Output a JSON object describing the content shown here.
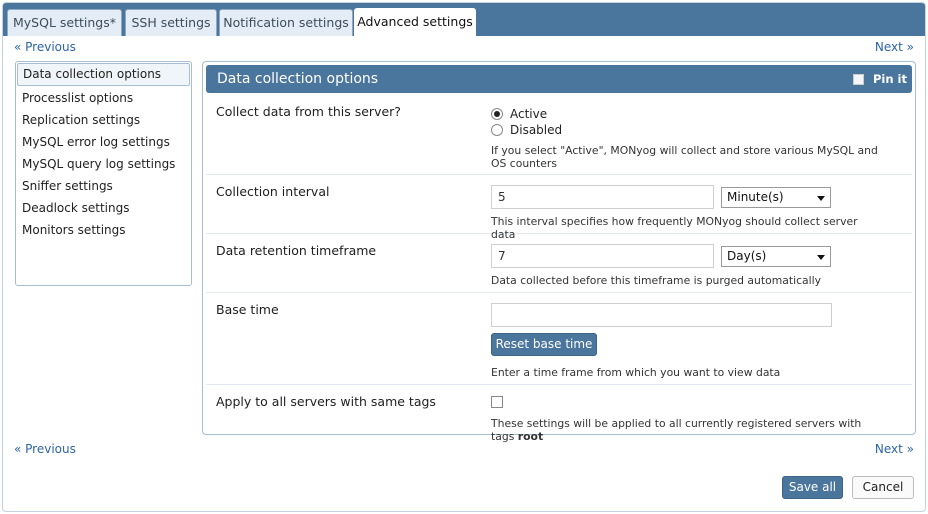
{
  "tabs": [
    {
      "label": "MySQL settings*"
    },
    {
      "label": "SSH settings"
    },
    {
      "label": "Notification settings"
    },
    {
      "label": "Advanced settings"
    }
  ],
  "nav": {
    "previous": "« Previous",
    "next": "Next »"
  },
  "sidebar": {
    "items": [
      {
        "label": "Data collection options"
      },
      {
        "label": "Processlist options"
      },
      {
        "label": "Replication settings"
      },
      {
        "label": "MySQL error log settings"
      },
      {
        "label": "MySQL query log settings"
      },
      {
        "label": "Sniffer settings"
      },
      {
        "label": "Deadlock settings"
      },
      {
        "label": "Monitors settings"
      }
    ]
  },
  "panel": {
    "title": "Data collection options",
    "pin_label": "Pin it",
    "pin_checked": false
  },
  "collect": {
    "label": "Collect data from this server?",
    "options": [
      {
        "label": "Active",
        "checked": true
      },
      {
        "label": "Disabled",
        "checked": false
      }
    ],
    "help": "If you select \"Active\", MONyog will collect and store various MySQL and OS counters"
  },
  "interval": {
    "label": "Collection interval",
    "value": "5",
    "unit": "Minute(s)",
    "help": "This interval specifies how frequently MONyog should collect server data"
  },
  "retention": {
    "label": "Data retention timeframe",
    "value": "7",
    "unit": "Day(s)",
    "help": "Data collected before this timeframe is purged automatically"
  },
  "base_time": {
    "label": "Base time",
    "value": "",
    "button": "Reset base time",
    "help": "Enter a time frame from which you want to view data"
  },
  "apply_tags": {
    "label": "Apply to all servers with same tags",
    "checked": false,
    "help_prefix": "These settings will be applied to all currently registered servers with tags",
    "tag": "root"
  },
  "footer": {
    "save_all": "Save all",
    "cancel": "Cancel"
  },
  "colors": {
    "header_blue": "#4a759c",
    "link_blue": "#2c64a8",
    "tab_inactive": "#e4edf5"
  }
}
